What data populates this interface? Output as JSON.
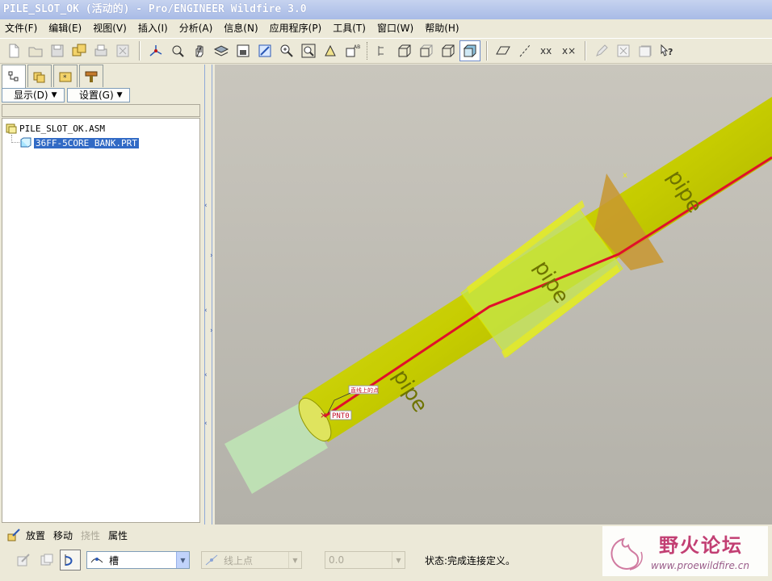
{
  "window": {
    "title": "PILE_SLOT_OK (活动的) - Pro/ENGINEER Wildfire 3.0"
  },
  "menubar": [
    {
      "label": "文件(F)"
    },
    {
      "label": "编辑(E)"
    },
    {
      "label": "视图(V)"
    },
    {
      "label": "插入(I)"
    },
    {
      "label": "分析(A)"
    },
    {
      "label": "信息(N)"
    },
    {
      "label": "应用程序(P)"
    },
    {
      "label": "工具(T)"
    },
    {
      "label": "窗口(W)"
    },
    {
      "label": "帮助(H)"
    }
  ],
  "toolbar": {
    "icons": [
      "new-file-icon",
      "open-file-icon",
      "save-icon",
      "save-copy-icon",
      "print-icon",
      "erase-icon",
      "datum-axis-icon",
      "spin-center-icon",
      "pan-hand-icon",
      "layers-icon",
      "view-manager-icon",
      "repaint-icon",
      "zoom-in-icon",
      "zoom-window-icon",
      "orient-icon",
      "saved-views-icon",
      "datum-display-icon",
      "wireframe-icon",
      "hidden-line-icon",
      "no-hidden-icon",
      "shading-icon",
      "datum-plane-icon",
      "datum-axis-display-icon",
      "datum-point-icon",
      "csys-icon",
      "edit-icon",
      "close-window-icon",
      "regenerate-icon",
      "whats-this-icon"
    ]
  },
  "left_panel": {
    "tabs": [
      "model-tree-tab",
      "layer-tree-tab",
      "favorites-tab",
      "connections-tab"
    ],
    "display_dropdown": "显示(D)",
    "settings_dropdown": "设置(G)",
    "tree": {
      "root": "PILE_SLOT_OK.ASM",
      "child": "36FF-5CORE_BANK.PRT"
    }
  },
  "viewport": {
    "labels": {
      "annotation": "直线上的点",
      "point": "PNT0",
      "pipe_text": "pipe",
      "axis_marker": "x"
    },
    "colors": {
      "background": "#bdbab2",
      "pipe": "#cfd400",
      "pipe_highlight": "#e6ea25",
      "transparent_part": "#bfe7b5",
      "cable": "#e0102a",
      "datum_plane": "#c8962f"
    }
  },
  "dashboard": {
    "tabs": [
      {
        "label": "放置",
        "disabled": false
      },
      {
        "label": "移动",
        "disabled": false
      },
      {
        "label": "挠性",
        "disabled": true
      },
      {
        "label": "属性",
        "disabled": false
      }
    ],
    "connection_type": "槽",
    "constraint_type": "线上点",
    "offset_value": "0.0",
    "status": "状态:完成连接定义。"
  },
  "watermark": {
    "title": "野火论坛",
    "url": "www.proewildfire.cn"
  }
}
